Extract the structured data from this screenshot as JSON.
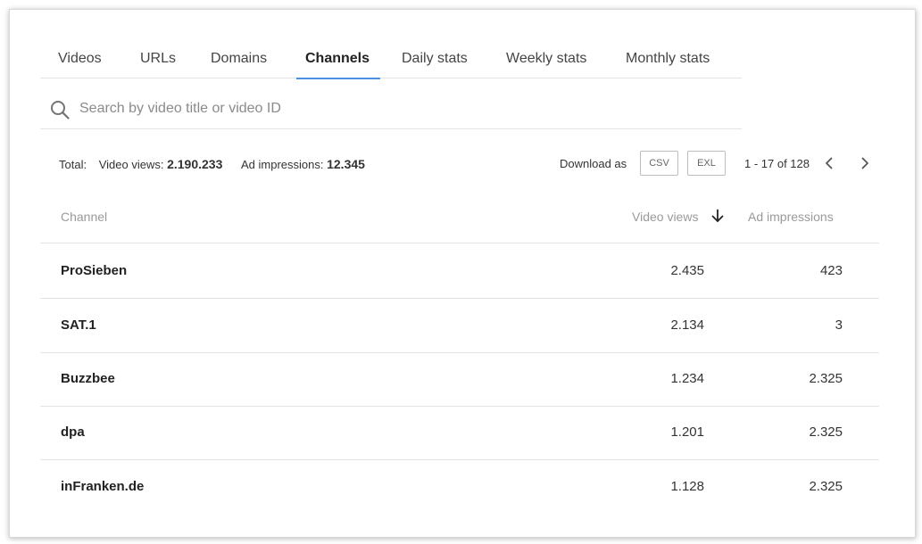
{
  "tabs": [
    {
      "label": "Videos",
      "active": false
    },
    {
      "label": "URLs",
      "active": false
    },
    {
      "label": "Domains",
      "active": false
    },
    {
      "label": "Channels",
      "active": true
    },
    {
      "label": "Daily stats",
      "active": false
    },
    {
      "label": "Weekly stats",
      "active": false
    },
    {
      "label": "Monthly stats",
      "active": false
    }
  ],
  "search": {
    "placeholder": "Search by video title or video ID",
    "value": ""
  },
  "totals": {
    "label": "Total:",
    "video_views_label": "Video views:",
    "video_views_value": "2.190.233",
    "ad_impressions_label": "Ad impressions:",
    "ad_impressions_value": "12.345"
  },
  "download": {
    "label": "Download as",
    "csv": "CSV",
    "exl": "EXL"
  },
  "pagination": {
    "range": "1 - 17 of 128"
  },
  "table": {
    "columns": {
      "channel": "Channel",
      "video_views": "Video views",
      "ad_impressions": "Ad impressions"
    },
    "sort": {
      "column": "video_views",
      "direction": "descending"
    },
    "rows": [
      {
        "channel": "ProSieben",
        "video_views": "2.435",
        "ad_impressions": "423"
      },
      {
        "channel": "SAT.1",
        "video_views": "2.134",
        "ad_impressions": "3"
      },
      {
        "channel": "Buzzbee",
        "video_views": "1.234",
        "ad_impressions": "2.325"
      },
      {
        "channel": "dpa",
        "video_views": "1.201",
        "ad_impressions": "2.325"
      },
      {
        "channel": "inFranken.de",
        "video_views": "1.128",
        "ad_impressions": "2.325"
      }
    ]
  },
  "colors": {
    "accent": "#4a90e2",
    "divider": "#e3e3e3",
    "muted_text": "#9a9a9a"
  }
}
